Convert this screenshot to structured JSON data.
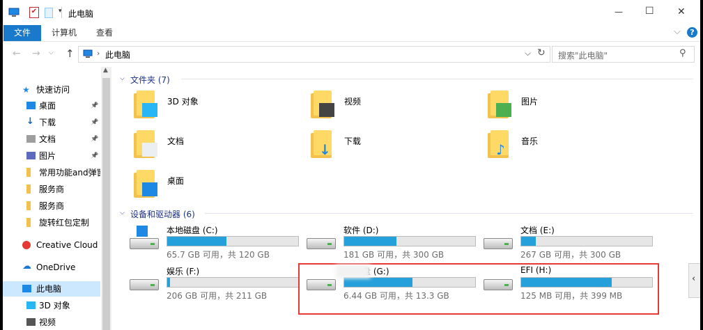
{
  "window": {
    "title": "此电脑",
    "minimize": "—",
    "maximize": "☐",
    "close": "✕"
  },
  "ribbon": {
    "tabs": [
      "文件",
      "计算机",
      "查看"
    ],
    "help": "?"
  },
  "address": {
    "path_label": "此电脑",
    "search_placeholder": "搜索\"此电脑\""
  },
  "sidebar": {
    "items": [
      {
        "label": "快速访问",
        "icon": "star-icon"
      },
      {
        "label": "桌面",
        "icon": "desktop-icon",
        "pinned": true
      },
      {
        "label": "下载",
        "icon": "download-icon",
        "pinned": true
      },
      {
        "label": "文档",
        "icon": "document-icon",
        "pinned": true
      },
      {
        "label": "图片",
        "icon": "picture-icon",
        "pinned": true
      },
      {
        "label": "常用功能and弹窗",
        "icon": "folder-icon"
      },
      {
        "label": "服务商",
        "icon": "folder-icon"
      },
      {
        "label": "服务商",
        "icon": "folder-icon"
      },
      {
        "label": "旋转红包定制",
        "icon": "folder-icon"
      },
      {
        "label": "Creative Cloud Files",
        "icon": "creative-cloud-icon"
      },
      {
        "label": "OneDrive",
        "icon": "onedrive-icon"
      },
      {
        "label": "此电脑",
        "icon": "this-pc-icon",
        "selected": true
      },
      {
        "label": "3D 对象",
        "icon": "3d-objects-icon"
      },
      {
        "label": "视频",
        "icon": "video-icon"
      }
    ]
  },
  "content": {
    "folders_header": "文件夹 (7)",
    "folders": [
      {
        "label": "3D 对象",
        "icon": "3d-objects-icon"
      },
      {
        "label": "视频",
        "icon": "video-icon"
      },
      {
        "label": "图片",
        "icon": "picture-icon"
      },
      {
        "label": "文档",
        "icon": "document-icon"
      },
      {
        "label": "下载",
        "icon": "download-icon"
      },
      {
        "label": "音乐",
        "icon": "music-icon"
      },
      {
        "label": "桌面",
        "icon": "desktop-icon"
      }
    ],
    "drives_header": "设备和驱动器 (6)",
    "drives": [
      {
        "label": "本地磁盘 (C:)",
        "info": "65.7 GB 可用，共 120 GB",
        "used_fraction": 0.45
      },
      {
        "label": "软件 (D:)",
        "info": "181 GB 可用，共 300 GB",
        "used_fraction": 0.4
      },
      {
        "label": "文档 (E:)",
        "info": "267 GB 可用，共 300 GB",
        "used_fraction": 0.11
      },
      {
        "label": "娱乐 (F:)",
        "info": "206 GB 可用，共 211 GB",
        "used_fraction": 0.02
      },
      {
        "label": "盘 (G:)",
        "info": "6.44 GB 可用，共 13.3 GB",
        "used_fraction": 0.52
      },
      {
        "label": "EFI (H:)",
        "info": "125 MB 可用，共 399 MB",
        "used_fraction": 0.69
      }
    ]
  },
  "highlight_color": "#e53935"
}
